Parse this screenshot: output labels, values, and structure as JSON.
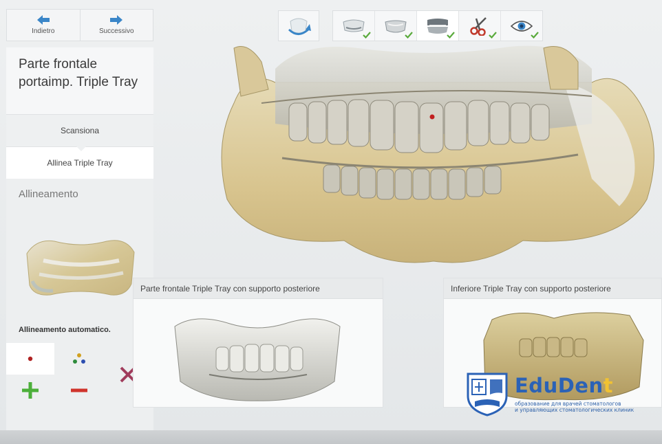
{
  "nav": {
    "back_label": "Indietro",
    "next_label": "Successivo"
  },
  "panel": {
    "title": "Parte frontale portaimp. Triple Tray",
    "step_scan": "Scansiona",
    "step_align": "Allinea Triple Tray",
    "section": "Allineamento",
    "auto_label": "Allineamento automatico."
  },
  "toolbar": {
    "items": [
      {
        "icon": "upper-jaw-icon",
        "done": true
      },
      {
        "icon": "lower-jaw-icon",
        "done": true
      },
      {
        "icon": "bite-icon",
        "done": true,
        "current": true
      },
      {
        "icon": "scissors-icon",
        "done": true
      },
      {
        "icon": "eye-icon",
        "done": true
      }
    ]
  },
  "subwindows": {
    "left_title": "Parte frontale Triple Tray con supporto posteriore",
    "right_title": "Inferiore Triple Tray con supporto posteriore"
  },
  "brand": {
    "name_part1": "EduDen",
    "name_part2": "t",
    "line1": "образование для врачей стоматологов",
    "line2": "и управляющих стоматологических клиник"
  },
  "colors": {
    "accent_blue": "#3a86c8",
    "check_green": "#5aaa3c",
    "plus_green": "#4caf3a",
    "minus_red": "#d0342c",
    "close_magenta": "#a03c5c",
    "model_beige": "#d9c89a",
    "brand_blue": "#2b62b6",
    "brand_yellow": "#f1c232"
  }
}
